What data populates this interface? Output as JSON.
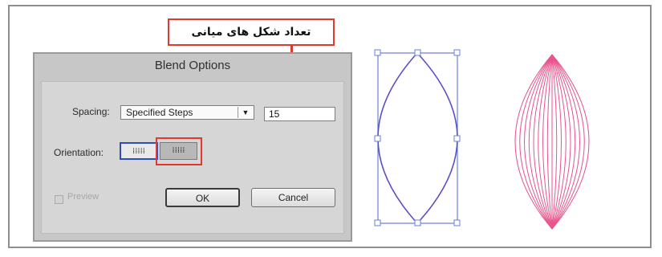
{
  "callout": {
    "text": "تعداد شکل های میانی"
  },
  "dialog": {
    "title": "Blend Options",
    "spacing_label": "Spacing:",
    "spacing_value": "Specified Steps",
    "spacing_arrow": "▼",
    "steps_value": "15",
    "orientation_label": "Orientation:",
    "orient_align_page": "⁞⁞⁞⁞⁞",
    "orient_align_path": "⁞⁞⁞⁞⁞",
    "preview_label": "Preview",
    "ok_label": "OK",
    "cancel_label": "Cancel"
  },
  "colors": {
    "highlight": "#e03a2e",
    "shape_outline": "#5b4fc9",
    "blend_lines": "#e8548e"
  },
  "icons": {
    "orient_page": "align-to-page-icon",
    "orient_path": "align-to-path-icon"
  }
}
